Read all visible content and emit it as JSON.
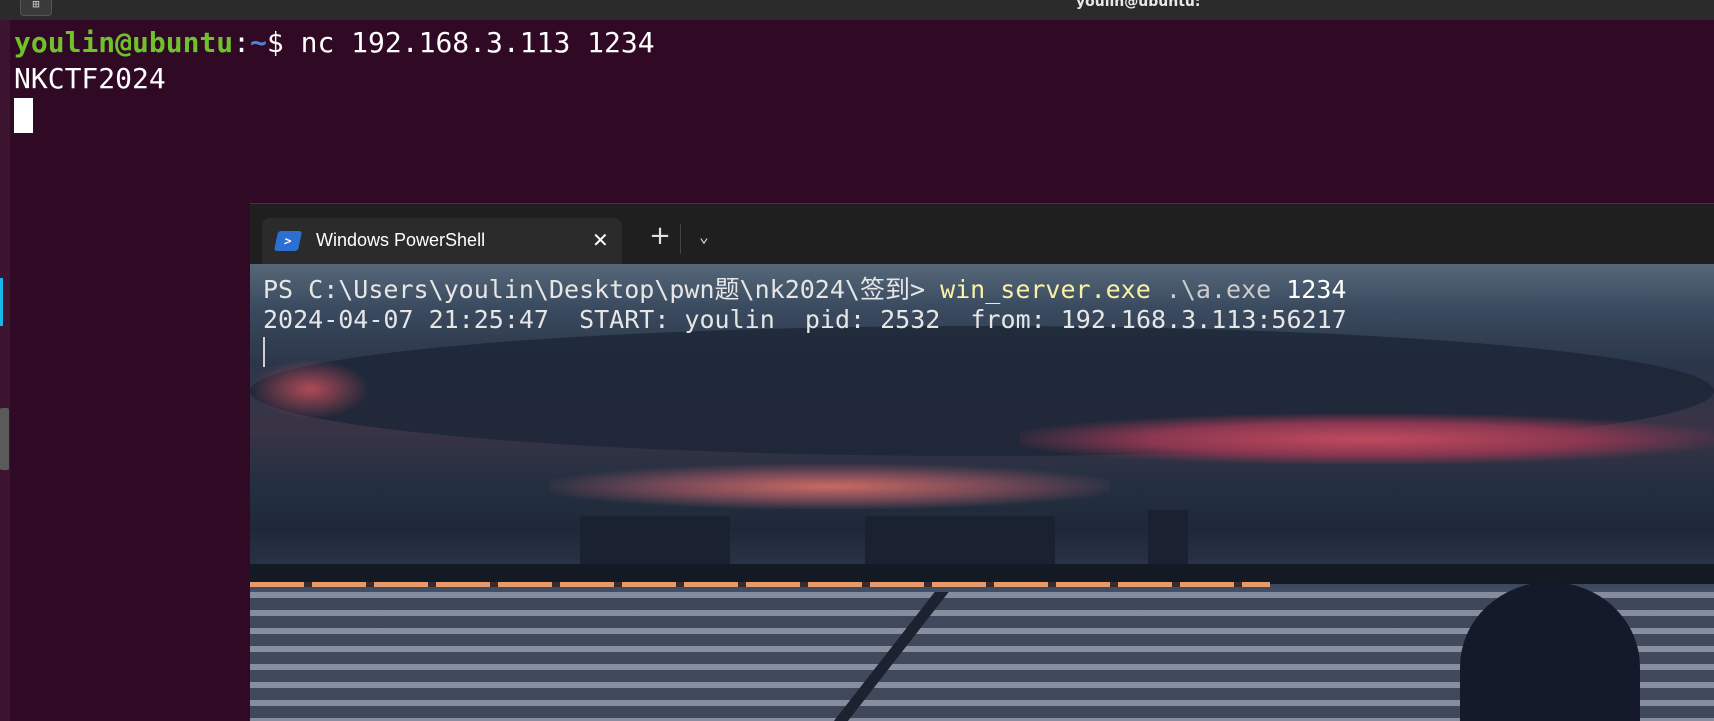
{
  "ubuntu": {
    "window_title": "youlin@ubuntu:",
    "prompt_user_host": "youlin@ubuntu",
    "prompt_sep": ":",
    "prompt_path": "~",
    "prompt_symbol": "$ ",
    "command": "nc 192.168.3.113 1234",
    "output": "NKCTF2024"
  },
  "powershell": {
    "tab_title": "Windows PowerShell",
    "tab_icon": "powershell-icon",
    "close_icon": "close-icon",
    "new_tab_icon": "plus-icon",
    "dropdown_icon": "chevron-down-icon",
    "prompt": "PS C:\\Users\\youlin\\Desktop\\pwn题\\nk2024\\签到> ",
    "command": "win_server.exe",
    "arg_path": " .\\a.exe",
    "arg_port": " 1234",
    "output": "2024-04-07 21:25:47  START: youlin  pid: 2532  from: 192.168.3.113:56217"
  },
  "colors": {
    "ubuntu_bg": "#300a24",
    "prompt_user": "#6fc22a",
    "prompt_path": "#4f86d8",
    "ps_command": "#f9f1a5"
  }
}
